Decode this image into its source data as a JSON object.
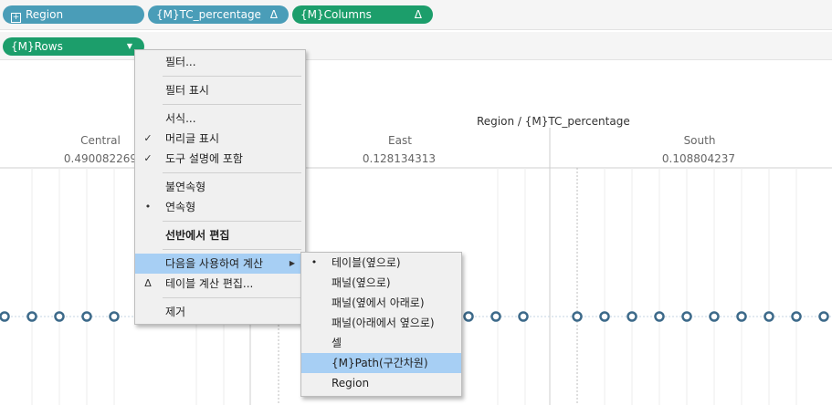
{
  "shelves": {
    "pills": [
      {
        "label": "Region",
        "icon": "plus-box-icon"
      },
      {
        "label": "{M}TC_percentage",
        "suffix": "Δ"
      },
      {
        "label": "{M}Columns",
        "suffix": "Δ"
      }
    ],
    "rows_pill": {
      "label": "{M}Rows",
      "caret": "▼"
    }
  },
  "view": {
    "header_title": "Region / {M}TC_percentage",
    "columns": [
      {
        "label": "Central",
        "value": "0.490082269"
      },
      {
        "label": "East",
        "value": "0.128134313"
      },
      {
        "label": "South",
        "value": "0.108804237"
      }
    ]
  },
  "context_menu": {
    "items": [
      {
        "label": "필터..."
      },
      {
        "label": "필터 표시"
      },
      {
        "label": "서식..."
      },
      {
        "label": "머리글 표시",
        "mark": "✓"
      },
      {
        "label": "도구 설명에 포함",
        "mark": "✓"
      },
      {
        "label": "불연속형"
      },
      {
        "label": "연속형",
        "mark": "•"
      },
      {
        "label": "선반에서 편집"
      },
      {
        "label": "다음을 사용하여 계산",
        "arrow": "▶"
      },
      {
        "label": "테이블 계산 편집...",
        "mark": "Δ"
      },
      {
        "label": "제거"
      }
    ]
  },
  "submenu": {
    "items": [
      {
        "label": "테이블(옆으로)",
        "mark": "•"
      },
      {
        "label": "패널(옆으로)"
      },
      {
        "label": "패널(옆에서 아래로)"
      },
      {
        "label": "패널(아래에서 옆으로)"
      },
      {
        "label": "셀"
      },
      {
        "label": "{M}Path(구간차원)"
      },
      {
        "label": "Region"
      }
    ]
  },
  "colors": {
    "region_pill": "#4a9db8",
    "measure_pill": "#1c9e6b",
    "menu_highlight": "#a7cff4",
    "marker_stroke": "#3d6a8a"
  }
}
